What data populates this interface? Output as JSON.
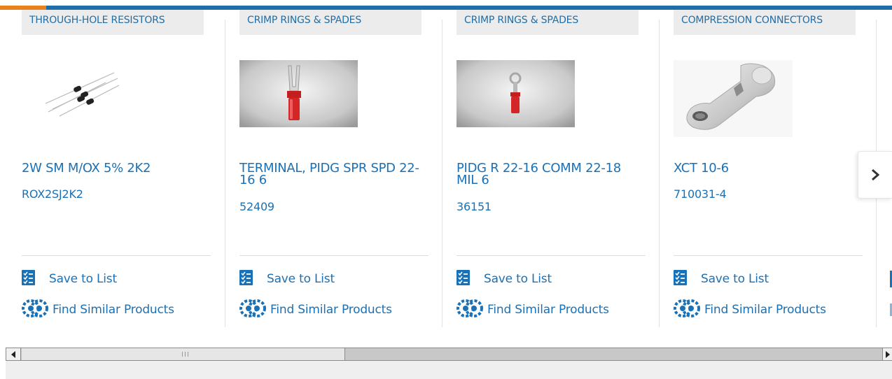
{
  "colors": {
    "brand_blue": "#1f6ea8",
    "link_blue": "#1b71b6",
    "accent_orange": "#e8821d",
    "tag_bg": "#ececec"
  },
  "products": [
    {
      "category": "THROUGH-HOLE RESISTORS",
      "image_icon": "resistors-product-image",
      "title": "2W SM M/OX 5% 2K2",
      "part_number": "ROX2SJ2K2",
      "save_label": "Save to List",
      "find_label": "Find Similar Products"
    },
    {
      "category": "CRIMP RINGS & SPADES",
      "image_icon": "spade-terminal-product-image",
      "title": "TERMINAL, PIDG SPR SPD 22-16 6",
      "part_number": "52409",
      "save_label": "Save to List",
      "find_label": "Find Similar Products"
    },
    {
      "category": "CRIMP RINGS & SPADES",
      "image_icon": "ring-terminal-product-image",
      "title": "PIDG R 22-16 COMM 22-18 MIL 6",
      "part_number": "36151",
      "save_label": "Save to List",
      "find_label": "Find Similar Products"
    },
    {
      "category": "COMPRESSION CONNECTORS",
      "image_icon": "compression-lug-product-image",
      "title": "XCT 10-6",
      "part_number": "710031-4",
      "save_label": "Save to List",
      "find_label": "Find Similar Products"
    }
  ],
  "carousel": {
    "next_icon": "chevron-right-icon"
  },
  "scrollbar": {
    "left_icon": "scroll-left-arrow-icon",
    "right_icon": "scroll-right-arrow-icon"
  }
}
